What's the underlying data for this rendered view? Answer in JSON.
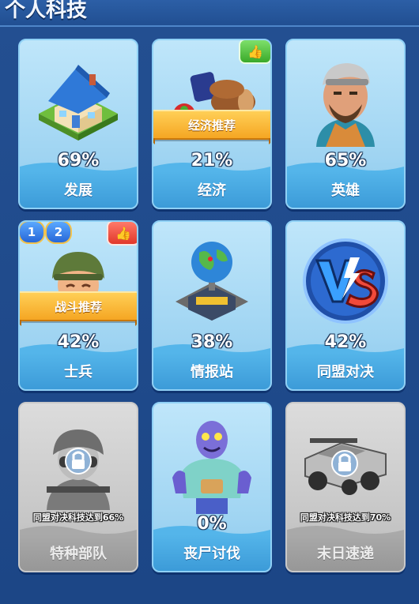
{
  "header": {
    "title": "个人科技"
  },
  "cards": [
    {
      "name": "发展",
      "percent": "69%"
    },
    {
      "name": "经济",
      "percent": "21%",
      "ribbon": "经济推荐",
      "badge_icon": "thumbs-up-icon"
    },
    {
      "name": "英雄",
      "percent": "65%"
    },
    {
      "name": "士兵",
      "percent": "42%",
      "ribbon": "战斗推荐",
      "badge_icon": "thumbs-up-icon",
      "levels": [
        "1",
        "2"
      ]
    },
    {
      "name": "情报站",
      "percent": "38%"
    },
    {
      "name": "同盟对决",
      "percent": "42%",
      "emblem": "VS"
    },
    {
      "name": "特种部队",
      "locked": true,
      "lock_text": "同盟对决科技达到66%"
    },
    {
      "name": "丧尸讨伐",
      "percent": "0%"
    },
    {
      "name": "末日速递",
      "locked": true,
      "lock_text": "同盟对决科技达到70%"
    }
  ],
  "colors": {
    "accent": "#3c9bd8",
    "ribbon": "#f5a623",
    "background": "#1d4f93"
  }
}
